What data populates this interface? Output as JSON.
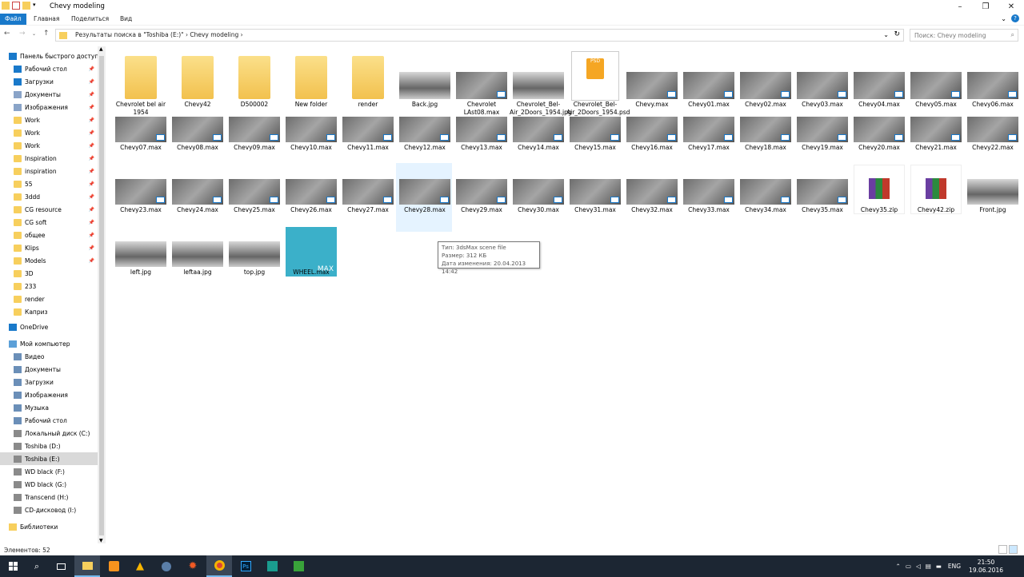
{
  "window": {
    "title": "Chevy modeling"
  },
  "ribbon": {
    "tabs": [
      "Файл",
      "Главная",
      "Поделиться",
      "Вид"
    ]
  },
  "address": {
    "crumbs": "Результаты поиска в \"Toshiba (E:)\"   ›   Chevy modeling   ›"
  },
  "search": {
    "placeholder": "Поиск: Chevy modeling"
  },
  "sidebar": {
    "quick_access": "Панель быстрого доступа",
    "quick_items": [
      "Рабочий стол",
      "Загрузки",
      "Документы",
      "Изображения",
      "Work",
      "Work",
      "Work",
      "Inspiration",
      "inspiration",
      "55",
      "3ddd",
      "CG resource",
      "CG soft",
      "общее",
      "Klips",
      "Models",
      "3D",
      "233",
      "render",
      "Каприз"
    ],
    "onedrive": "OneDrive",
    "computer": "Мой компьютер",
    "computer_items": [
      "Видео",
      "Документы",
      "Загрузки",
      "Изображения",
      "Музыка",
      "Рабочий стол",
      "Локальный диск (C:)",
      "Toshiba  (D:)",
      "Toshiba  (E:)",
      "WD black (F:)",
      "WD black (G:)",
      "Transcend (H:)",
      "CD-дисковод (I:)"
    ],
    "libraries": "Библиотеки"
  },
  "files": {
    "row1": [
      "Chevrolet bel air 1954",
      "Chevy42",
      "D500002",
      "New folder",
      "render",
      "Back.jpg",
      "Chevrolet LAst08.max",
      "Chevrolet_Bel-Air_2Doors_1954.jpg",
      "Chevrolet_Bel-Air_2Doors_1954.psd",
      "Chevy.max",
      "Chevy01.max",
      "Chevy02.max",
      "Chevy03.max",
      "Chevy04.max",
      "Chevy05.max",
      "Chevy06.max"
    ],
    "row2": [
      "Chevy07.max",
      "Chevy08.max",
      "Chevy09.max",
      "Chevy10.max",
      "Chevy11.max",
      "Chevy12.max",
      "Chevy13.max",
      "Chevy14.max",
      "Chevy15.max",
      "Chevy16.max",
      "Chevy17.max",
      "Chevy18.max",
      "Chevy19.max",
      "Chevy20.max",
      "Chevy21.max",
      "Chevy22.max"
    ],
    "row3": [
      "Chevy23.max",
      "Chevy24.max",
      "Chevy25.max",
      "Chevy26.max",
      "Chevy27.max",
      "Chevy28.max",
      "Chevy29.max",
      "Chevy30.max",
      "Chevy31.max",
      "Chevy32.max",
      "Chevy33.max",
      "Chevy34.max",
      "Chevy35.max",
      "Chevy35.zip",
      "Chevy42.zip",
      "Front.jpg"
    ],
    "row4": [
      "left.jpg",
      "leftaa.jpg",
      "top.jpg",
      "WHEEL.max"
    ]
  },
  "tooltip": {
    "line1": "Тип: 3dsMax scene file",
    "line2": "Размер: 312 КБ",
    "line3": "Дата изменения: 20.04.2013 14:42"
  },
  "status": {
    "count": "Элементов: 52"
  },
  "tray": {
    "lang": "ENG",
    "time": "21:50",
    "date": "19.06.2016"
  },
  "colors": {
    "accent": "#1979ca",
    "taskbar": "#1c2633",
    "folder": "#f7cf5d",
    "selection": "#e5f3ff"
  }
}
